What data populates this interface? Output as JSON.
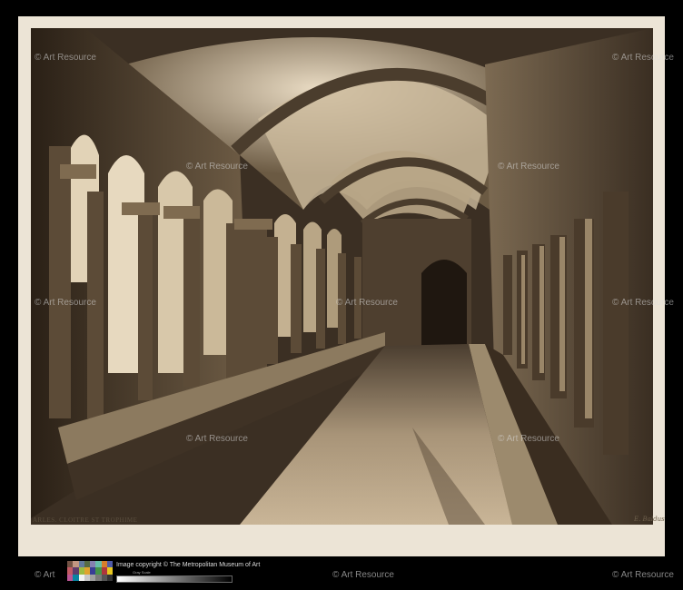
{
  "caption": "ARLES. CLOITRE ST TROPHIME",
  "signature": "E. Baldus",
  "watermark_text": "© Art Resource",
  "copyright": "Image copyright © The Metropolitan Museum of Art",
  "gray_scale_label": "Gray Scale",
  "colors": {
    "background": "#000000",
    "mount": "#ece4d6",
    "photo_tone": "#2a2016"
  },
  "color_patches": [
    "#735244",
    "#c29682",
    "#627a9d",
    "#576c43",
    "#8580b1",
    "#67bdaa",
    "#d67e2c",
    "#505ba6",
    "#c15a63",
    "#5e3c6c",
    "#9dbc40",
    "#e0a32e",
    "#383d96",
    "#469449",
    "#af363c",
    "#e7c71f",
    "#bb5695",
    "#0885a1",
    "#f3f3f2",
    "#c8c8c8",
    "#a0a0a0",
    "#7a7a79",
    "#555555",
    "#343434"
  ]
}
